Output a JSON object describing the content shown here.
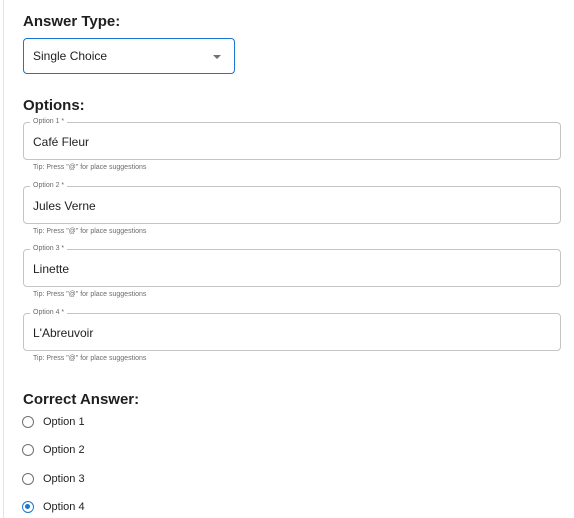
{
  "answer_type": {
    "heading": "Answer Type:",
    "selected": "Single Choice"
  },
  "options": {
    "heading": "Options:",
    "fields": [
      {
        "label": "Option 1 *",
        "value": "Café Fleur",
        "helper": "Tip: Press \"@\" for place suggestions"
      },
      {
        "label": "Option 2 *",
        "value": "Jules Verne",
        "helper": "Tip: Press \"@\" for place suggestions"
      },
      {
        "label": "Option 3 *",
        "value": "Linette",
        "helper": "Tip: Press \"@\" for place suggestions"
      },
      {
        "label": "Option 4 *",
        "value": "L'Abreuvoir",
        "helper": "Tip: Press \"@\" for place suggestions"
      }
    ]
  },
  "correct_answer": {
    "heading": "Correct Answer:",
    "choices": [
      {
        "label": "Option 1",
        "checked": false
      },
      {
        "label": "Option 2",
        "checked": false
      },
      {
        "label": "Option 3",
        "checked": false
      },
      {
        "label": "Option 4",
        "checked": true
      }
    ]
  },
  "colors": {
    "accent": "#1976d2",
    "field_border": "#c4c4c4",
    "helper_text": "#6b6b6b"
  }
}
